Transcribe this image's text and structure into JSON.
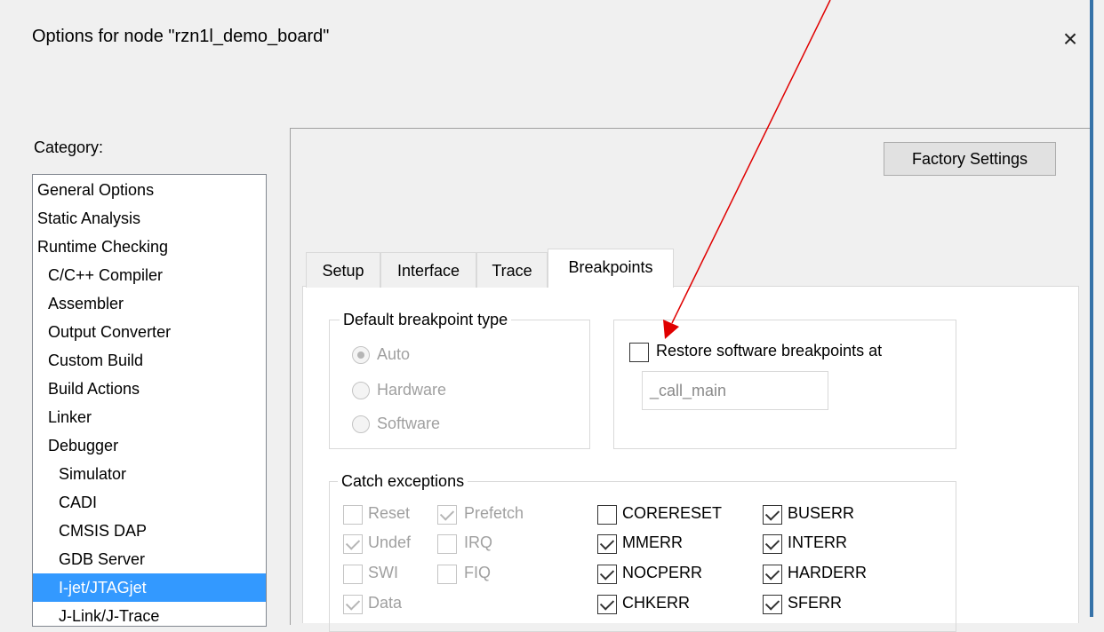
{
  "window": {
    "title": "Options for node \"rzn1l_demo_board\"",
    "close_glyph": "×"
  },
  "category": {
    "label": "Category:",
    "items": [
      {
        "label": "General Options",
        "indent": 0
      },
      {
        "label": "Static Analysis",
        "indent": 0
      },
      {
        "label": "Runtime Checking",
        "indent": 0
      },
      {
        "label": "C/C++ Compiler",
        "indent": 1
      },
      {
        "label": "Assembler",
        "indent": 1
      },
      {
        "label": "Output Converter",
        "indent": 1
      },
      {
        "label": "Custom Build",
        "indent": 1
      },
      {
        "label": "Build Actions",
        "indent": 1
      },
      {
        "label": "Linker",
        "indent": 1
      },
      {
        "label": "Debugger",
        "indent": 1
      },
      {
        "label": "Simulator",
        "indent": 2
      },
      {
        "label": "CADI",
        "indent": 2
      },
      {
        "label": "CMSIS DAP",
        "indent": 2
      },
      {
        "label": "GDB Server",
        "indent": 2
      },
      {
        "label": "I-jet/JTAGjet",
        "indent": 2,
        "selected": true
      },
      {
        "label": "J-Link/J-Trace",
        "indent": 2
      }
    ]
  },
  "factory_settings_label": "Factory Settings",
  "tabs": [
    "Setup",
    "Interface",
    "Trace",
    "Breakpoints"
  ],
  "active_tab": "Breakpoints",
  "default_bp": {
    "title": "Default breakpoint type",
    "options": [
      {
        "label": "Auto",
        "selected": true
      },
      {
        "label": "Hardware",
        "selected": false
      },
      {
        "label": "Software",
        "selected": false
      }
    ]
  },
  "restore": {
    "label": "Restore software breakpoints at",
    "checked": false,
    "value": "_call_main"
  },
  "catch": {
    "title": "Catch exceptions",
    "disabled_items": [
      {
        "label": "Reset",
        "checked": false
      },
      {
        "label": "Prefetch",
        "checked": true
      },
      {
        "label": "Undef",
        "checked": true
      },
      {
        "label": "IRQ",
        "checked": false
      },
      {
        "label": "SWI",
        "checked": false
      },
      {
        "label": "FIQ",
        "checked": false
      },
      {
        "label": "Data",
        "checked": true
      }
    ],
    "items": [
      {
        "label": "CORERESET",
        "checked": false
      },
      {
        "label": "BUSERR",
        "checked": true
      },
      {
        "label": "MMERR",
        "checked": true
      },
      {
        "label": "INTERR",
        "checked": true
      },
      {
        "label": "NOCPERR",
        "checked": true
      },
      {
        "label": "HARDERR",
        "checked": true
      },
      {
        "label": "CHKERR",
        "checked": true
      },
      {
        "label": "SFERR",
        "checked": true
      }
    ]
  },
  "colors": {
    "selection": "#3399ff",
    "annotation_arrow": "#e00000"
  }
}
